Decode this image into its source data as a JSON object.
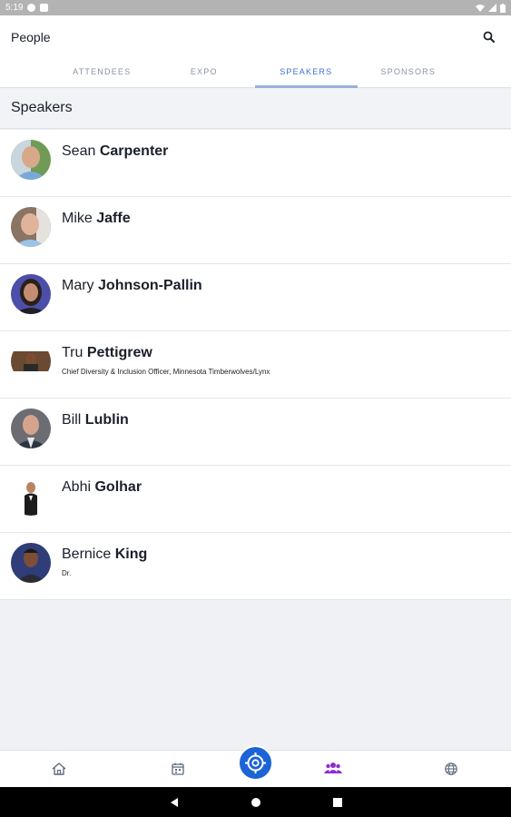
{
  "status_bar": {
    "time": "5:19"
  },
  "header": {
    "title": "People"
  },
  "tabs": [
    {
      "label": "ATTENDEES",
      "active": false
    },
    {
      "label": "EXPO",
      "active": false
    },
    {
      "label": "SPEAKERS",
      "active": true
    },
    {
      "label": "SPONSORS",
      "active": false
    }
  ],
  "section": {
    "title": "Speakers"
  },
  "speakers": [
    {
      "first": "Sean",
      "last": "Carpenter",
      "subtitle": ""
    },
    {
      "first": "Mike",
      "last": "Jaffe",
      "subtitle": ""
    },
    {
      "first": "Mary",
      "last": "Johnson-Pallin",
      "subtitle": ""
    },
    {
      "first": "Tru",
      "last": "Pettigrew",
      "subtitle": "Chief Diversity & Inclusion Officer, Minnesota Timberwolves/Lynx"
    },
    {
      "first": "Bill",
      "last": "Lublin",
      "subtitle": ""
    },
    {
      "first": "Abhi",
      "last": "Golhar",
      "subtitle": ""
    },
    {
      "first": "Bernice",
      "last": "King",
      "subtitle": "Dr."
    }
  ],
  "bottom_nav": {
    "items": [
      "home-icon",
      "calendar-icon",
      "target-icon",
      "people-icon",
      "globe-icon"
    ],
    "active": "people-icon"
  },
  "colors": {
    "accent": "#3b6fd8",
    "center_button": "#1b63d6",
    "active_nav": "#8e2bd0"
  }
}
